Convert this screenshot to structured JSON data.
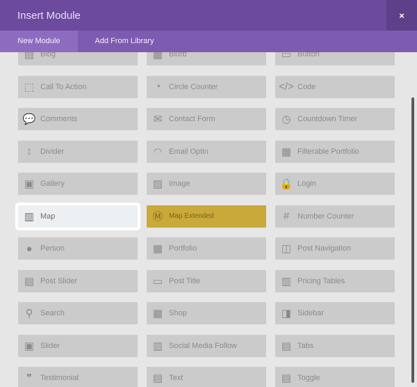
{
  "window": {
    "title": "Insert Module",
    "close_glyph": "×"
  },
  "tabs": [
    {
      "label": "New Module",
      "active": true
    },
    {
      "label": "Add From Library",
      "active": false
    }
  ],
  "modules": [
    {
      "label": "Blog",
      "icon": "blog-icon"
    },
    {
      "label": "Blurb",
      "icon": "blurb-icon"
    },
    {
      "label": "Button",
      "icon": "button-icon"
    },
    {
      "label": "Call To Action",
      "icon": "call-to-action-icon"
    },
    {
      "label": "Circle Counter",
      "icon": "circle-counter-icon"
    },
    {
      "label": "Code",
      "icon": "code-icon"
    },
    {
      "label": "Comments",
      "icon": "comments-icon"
    },
    {
      "label": "Contact Form",
      "icon": "envelope-icon"
    },
    {
      "label": "Countdown Timer",
      "icon": "timer-icon"
    },
    {
      "label": "Divider",
      "icon": "divider-icon"
    },
    {
      "label": "Email Optin",
      "icon": "rss-icon"
    },
    {
      "label": "Filterable Portfolio",
      "icon": "filterable-grid-icon"
    },
    {
      "label": "Gallery",
      "icon": "gallery-icon"
    },
    {
      "label": "Image",
      "icon": "image-icon"
    },
    {
      "label": "Login",
      "icon": "lock-icon"
    },
    {
      "label": "Map",
      "icon": "map-icon"
    },
    {
      "label": "Map Extended",
      "icon": "map-extended-icon"
    },
    {
      "label": "Number Counter",
      "icon": "hash-icon"
    },
    {
      "label": "Person",
      "icon": "person-icon"
    },
    {
      "label": "Portfolio",
      "icon": "grid-icon"
    },
    {
      "label": "Post Navigation",
      "icon": "post-navigation-icon"
    },
    {
      "label": "Post Slider",
      "icon": "post-slider-icon"
    },
    {
      "label": "Post Title",
      "icon": "post-title-icon"
    },
    {
      "label": "Pricing Tables",
      "icon": "pricing-tables-icon"
    },
    {
      "label": "Search",
      "icon": "search-icon"
    },
    {
      "label": "Shop",
      "icon": "shop-icon"
    },
    {
      "label": "Sidebar",
      "icon": "sidebar-icon"
    },
    {
      "label": "Slider",
      "icon": "slider-icon"
    },
    {
      "label": "Social Media Follow",
      "icon": "social-media-icon"
    },
    {
      "label": "Tabs",
      "icon": "tabs-icon"
    },
    {
      "label": "Testimonial",
      "icon": "quote-icon"
    },
    {
      "label": "Text",
      "icon": "text-icon"
    },
    {
      "label": "Toggle",
      "icon": "toggle-icon"
    }
  ],
  "colors": {
    "title_bar": "#6c4a9e",
    "tab_bar": "#7d5bb0",
    "highlight": "#c9a93a",
    "selected_background": "#edf0f2"
  }
}
